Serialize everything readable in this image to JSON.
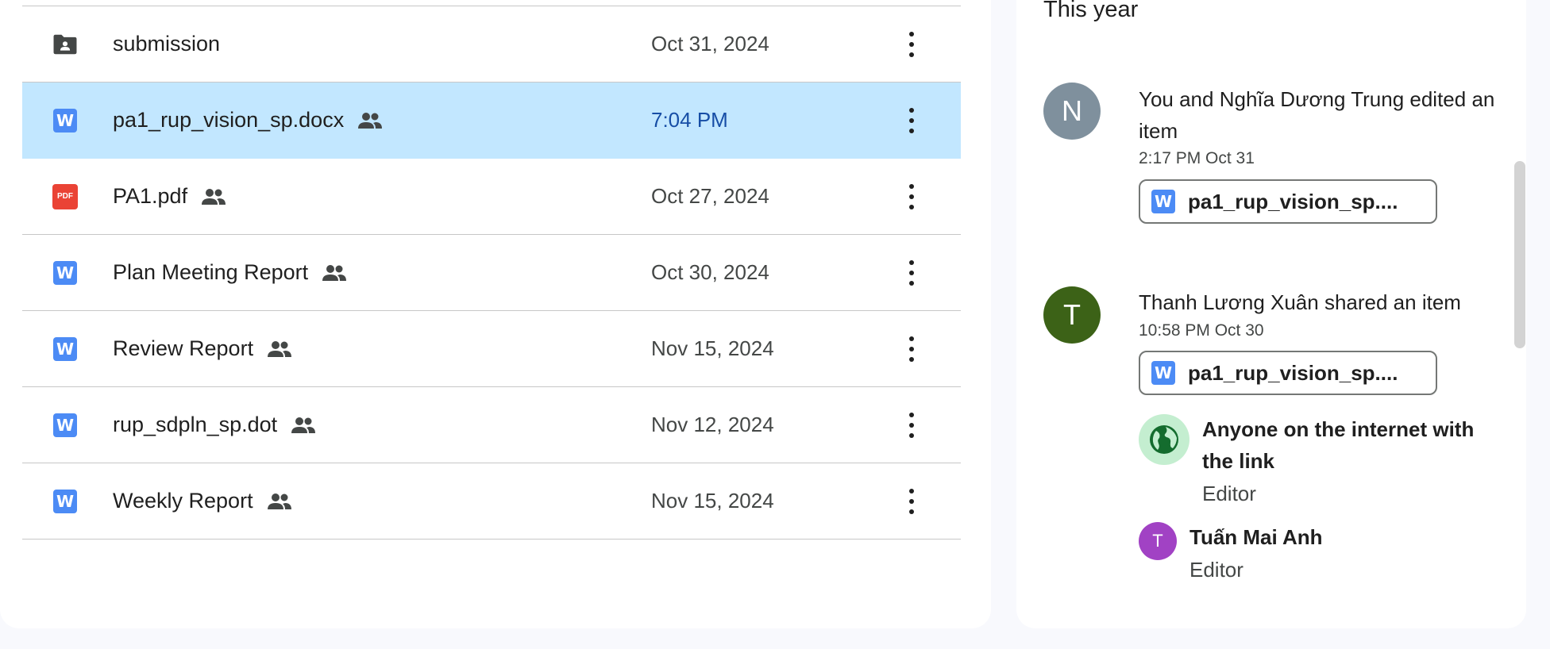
{
  "files": [
    {
      "name": "submission",
      "type": "folder",
      "shared": false,
      "date": "Oct 31, 2024",
      "selected": false
    },
    {
      "name": "pa1_rup_vision_sp.docx",
      "type": "doc",
      "shared": true,
      "date": "7:04 PM",
      "selected": true
    },
    {
      "name": "PA1.pdf",
      "type": "pdf",
      "shared": true,
      "date": "Oct 27, 2024",
      "selected": false
    },
    {
      "name": "Plan Meeting Report",
      "type": "doc",
      "shared": true,
      "date": "Oct 30, 2024",
      "selected": false
    },
    {
      "name": "Review Report",
      "type": "doc",
      "shared": true,
      "date": "Nov 15, 2024",
      "selected": false
    },
    {
      "name": "rup_sdpln_sp.dot",
      "type": "doc",
      "shared": true,
      "date": "Nov 12, 2024",
      "selected": false
    },
    {
      "name": "Weekly Report",
      "type": "doc",
      "shared": true,
      "date": "Nov 15, 2024",
      "selected": false
    }
  ],
  "icons": {
    "doc_letter": "W",
    "pdf_label": "PDF"
  },
  "activity": {
    "section_title": "This year",
    "items": [
      {
        "avatar_letter": "N",
        "avatar_color": "#7f909d",
        "text": "You and Nghĩa Dương Trung edited an item",
        "time": "2:17 PM Oct 31",
        "chip_label": "pa1_rup_vision_sp...."
      },
      {
        "avatar_letter": "T",
        "avatar_color": "#3c6217",
        "text": "Thanh Lương Xuân shared an item",
        "time": "10:58 PM Oct 30",
        "chip_label": "pa1_rup_vision_sp...."
      }
    ],
    "permissions": [
      {
        "name": "Anyone on the internet with the link",
        "role": "Editor",
        "icon": "globe-icon"
      },
      {
        "name": "Tuấn Mai Anh",
        "role": "Editor",
        "avatar_letter": "T",
        "avatar_color": "#a142c4"
      }
    ]
  },
  "colors": {
    "selected_row": "#c2e7ff",
    "doc_blue": "#4c8bf5",
    "pdf_red": "#ea4335"
  }
}
